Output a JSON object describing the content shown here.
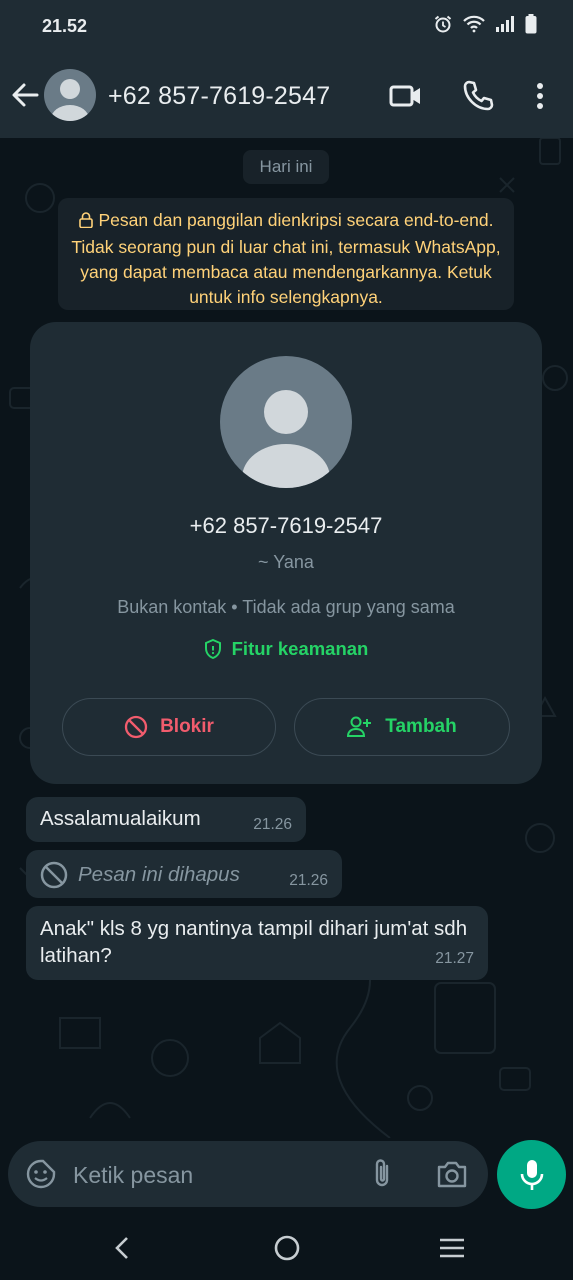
{
  "status_bar": {
    "time": "21.52",
    "icons": [
      "alarm-icon",
      "wifi-icon",
      "signal-icon",
      "battery-icon"
    ]
  },
  "header": {
    "title": "+62 857-7619-2547",
    "icons": [
      "back-arrow-icon",
      "avatar",
      "video-call-icon",
      "voice-call-icon",
      "more-options-icon"
    ]
  },
  "chat": {
    "date_chip": "Hari ini",
    "encryption_notice": "Pesan dan panggilan dienkripsi secara end-to-end. Tidak seorang pun di luar chat ini, termasuk WhatsApp, yang dapat membaca atau mendengarkannya. Ketuk untuk info selengkapnya.",
    "profile_card": {
      "phone": "+62 857-7619-2547",
      "name": "~ Yana",
      "info": "Bukan kontak • Tidak ada grup yang sama",
      "security_label": "Fitur keamanan",
      "block_label": "Blokir",
      "add_label": "Tambah"
    },
    "messages": [
      {
        "text": "Assalamualaikum",
        "time": "21.26",
        "deleted": false
      },
      {
        "text": "Pesan ini dihapus",
        "time": "21.26",
        "deleted": true
      },
      {
        "text": "Anak\" kls 8 yg nantinya tampil dihari jum'at sdh latihan?",
        "time": "21.27",
        "deleted": false
      }
    ]
  },
  "composer": {
    "placeholder": "Ketik pesan",
    "icons": [
      "sticker-icon",
      "attach-icon",
      "camera-icon",
      "mic-icon"
    ]
  },
  "colors": {
    "background": "#0b141a",
    "header": "#1f2c34",
    "bubble": "#1f2c34",
    "accent_green": "#25d366",
    "danger_red": "#f15c6d",
    "notice_yellow": "#ffd279",
    "mic_button": "#00a884"
  }
}
